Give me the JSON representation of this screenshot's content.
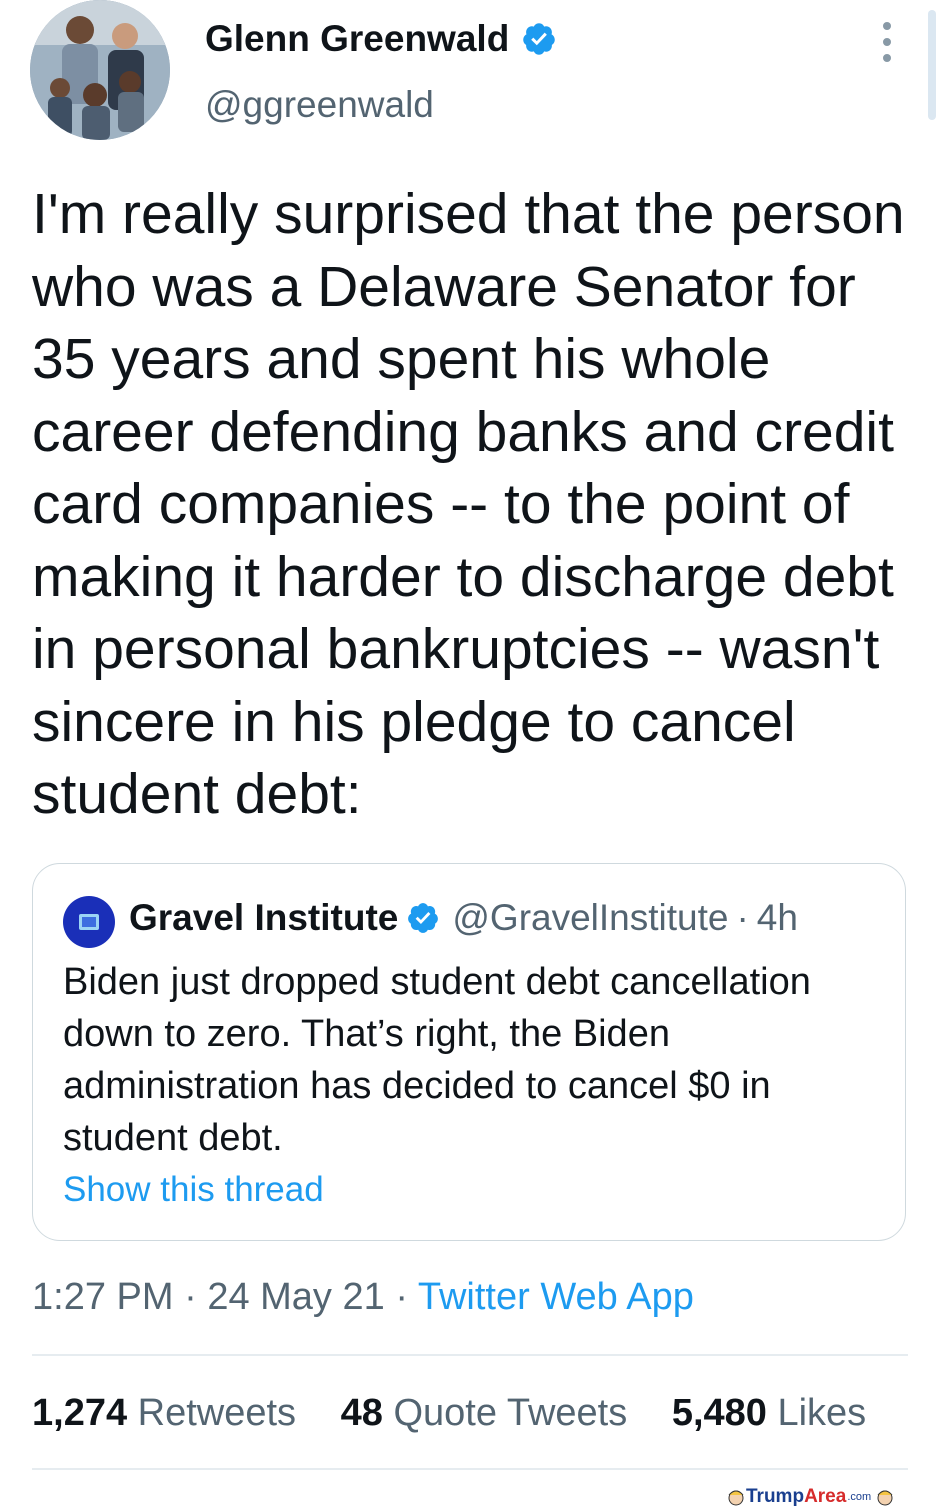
{
  "author": {
    "name": "Glenn Greenwald",
    "handle": "@ggreenwald",
    "verified_icon": "verified-badge-icon",
    "accent_color": "#1d9bf0"
  },
  "tweet": {
    "text": "I'm really surprised that the person\nwho was a Delaware Senator for\n35 years and spent his whole\ncareer defending banks and credit\ncard companies -- to the point of\nmaking it harder to discharge debt\nin personal bankruptcies -- wasn't\nsincere in his pledge to cancel\nstudent debt:"
  },
  "quoted_tweet": {
    "name": "Gravel Institute",
    "handle": "@GravelInstitute",
    "separator": "·",
    "age": "4h",
    "text": "Biden just dropped student debt cancellation\ndown to zero. That’s right, the Biden\nadministration has decided to cancel $0 in\nstudent debt.",
    "show_thread": "Show this thread"
  },
  "meta": {
    "time": "1:27 PM",
    "separator": "·",
    "date": "24 May 21",
    "source": "Twitter Web App"
  },
  "stats": {
    "retweets_count": "1,274",
    "retweets_label": "Retweets",
    "quotes_count": "48",
    "quotes_label": "Quote Tweets",
    "likes_count": "5,480",
    "likes_label": "Likes"
  },
  "watermark": {
    "part1": "Trump",
    "part2": "Area",
    "part3": ".com"
  }
}
